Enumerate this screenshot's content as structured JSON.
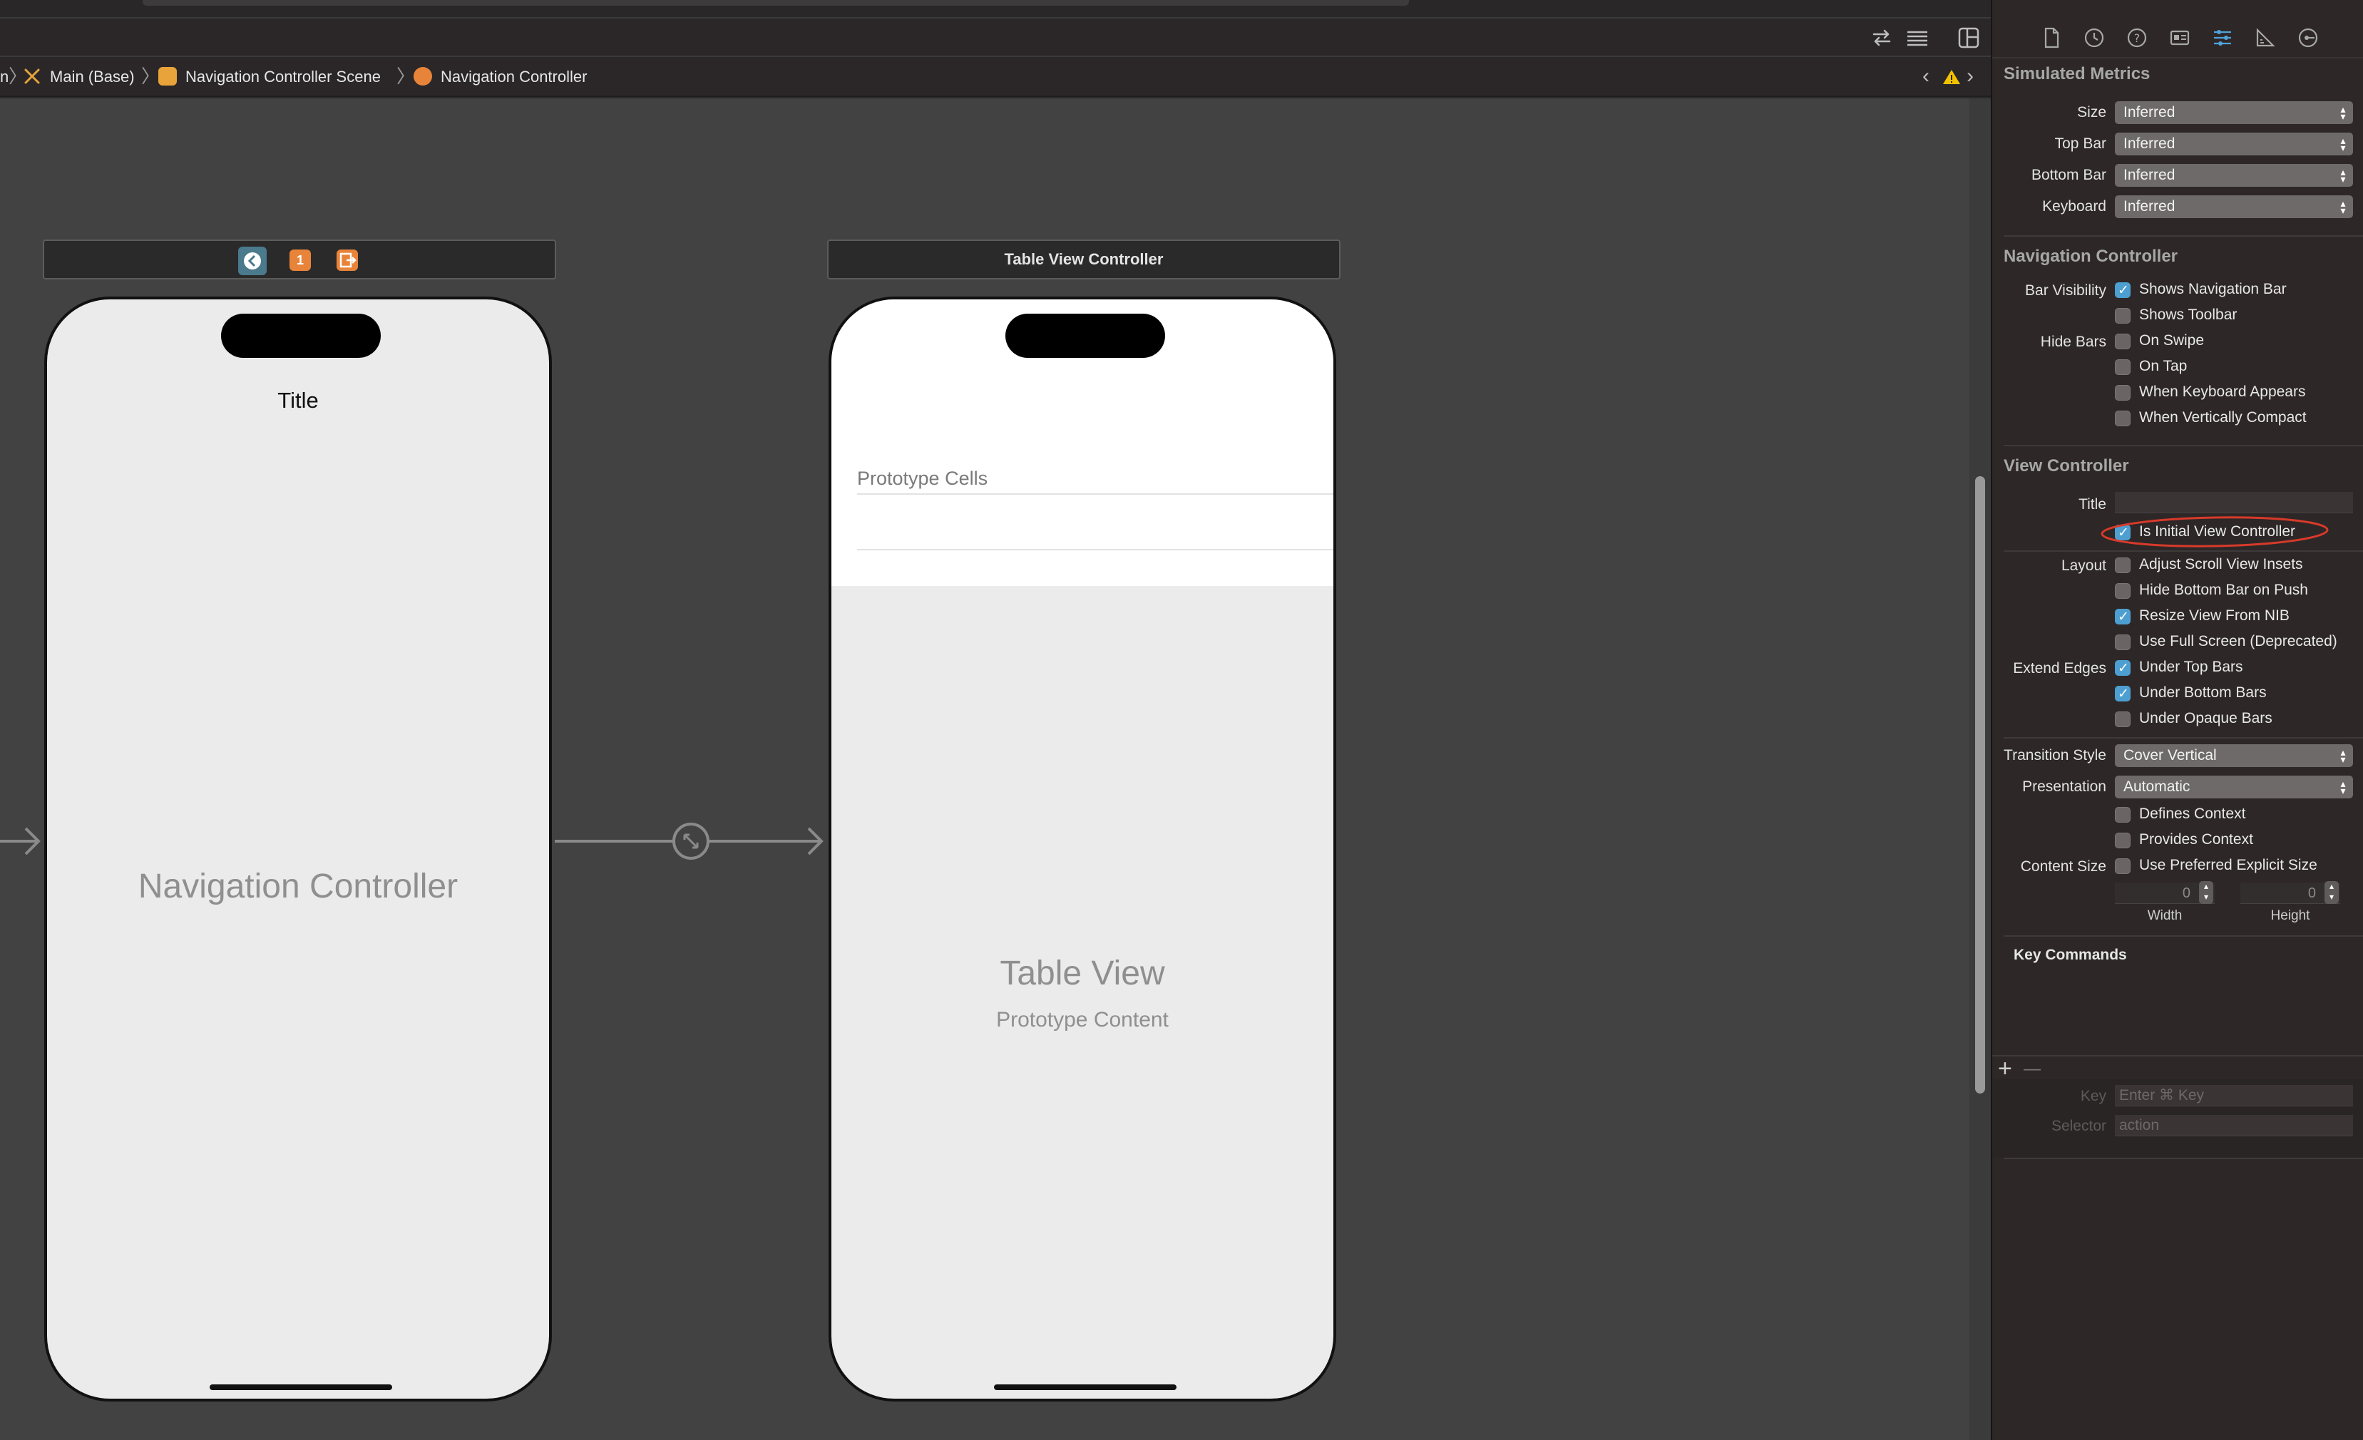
{
  "breadcrumb": {
    "items": [
      "Main (Base)",
      "Navigation Controller Scene",
      "Navigation Controller"
    ],
    "leading_partial": "n"
  },
  "canvas": {
    "nav_scene": {
      "device_title": "Title",
      "center_label": "Navigation Controller",
      "header_badge_number": "1"
    },
    "table_scene": {
      "header_title": "Table View Controller",
      "prototype_cells_label": "Prototype Cells",
      "center_title": "Table View",
      "center_subtitle": "Prototype Content"
    }
  },
  "inspector": {
    "simulated_metrics": {
      "title": "Simulated Metrics",
      "rows": [
        {
          "label": "Size",
          "value": "Inferred"
        },
        {
          "label": "Top Bar",
          "value": "Inferred"
        },
        {
          "label": "Bottom Bar",
          "value": "Inferred"
        },
        {
          "label": "Keyboard",
          "value": "Inferred"
        }
      ]
    },
    "navigation_controller": {
      "title": "Navigation Controller",
      "bar_visibility_label": "Bar Visibility",
      "hide_bars_label": "Hide Bars",
      "shows_navigation_bar": "Shows Navigation Bar",
      "shows_toolbar": "Shows Toolbar",
      "on_swipe": "On Swipe",
      "on_tap": "On Tap",
      "when_keyboard_appears": "When Keyboard Appears",
      "when_vertically_compact": "When Vertically Compact"
    },
    "view_controller": {
      "title": "View Controller",
      "title_field_label": "Title",
      "title_field_value": "",
      "is_initial": "Is Initial View Controller",
      "layout_label": "Layout",
      "adjust_scroll": "Adjust Scroll View Insets",
      "hide_bottom_bar": "Hide Bottom Bar on Push",
      "resize_view": "Resize View From NIB",
      "use_full_screen": "Use Full Screen (Deprecated)",
      "extend_edges_label": "Extend Edges",
      "under_top": "Under Top Bars",
      "under_bottom": "Under Bottom Bars",
      "under_opaque": "Under Opaque Bars",
      "transition_style_label": "Transition Style",
      "transition_style_value": "Cover Vertical",
      "presentation_label": "Presentation",
      "presentation_value": "Automatic",
      "defines_context": "Defines Context",
      "provides_context": "Provides Context",
      "content_size_label": "Content Size",
      "use_preferred_size": "Use Preferred Explicit Size",
      "width_value": "0",
      "height_value": "0",
      "width_caption": "Width",
      "height_caption": "Height"
    },
    "key_commands": {
      "title": "Key Commands",
      "add_symbol": "+",
      "remove_symbol": "—",
      "key_label": "Key",
      "key_placeholder": "Enter ⌘ Key",
      "selector_label": "Selector",
      "selector_value": "action"
    }
  },
  "colors": {
    "accent_checkbox": "#4d9fd1",
    "annotation_red": "#d83a2a",
    "warning_yellow": "#f2c200",
    "scene_icon_orange": "#e8843a"
  },
  "icons": {
    "toolbar": [
      "swap-arrows-icon",
      "list-lines-icon",
      "panel-layout-icon"
    ],
    "inspector_tabs": [
      "file-icon",
      "history-icon",
      "help-icon",
      "identity-icon",
      "attributes-icon",
      "size-ruler-icon",
      "connections-icon"
    ]
  }
}
